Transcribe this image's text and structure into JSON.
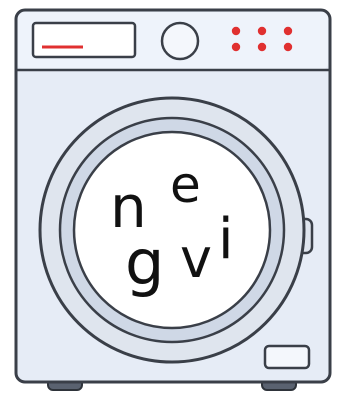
{
  "letters": {
    "n": "n",
    "e": "e",
    "g": "g",
    "v": "v",
    "i": "i"
  },
  "colors": {
    "body": "#e6ecf6",
    "outline": "#3a3f48",
    "panel_top": "#eef3fb",
    "drum_glass": "#ffffff",
    "door_ring": "#dfe5ee",
    "indicator_red": "#e03030",
    "feet": "#5a6270"
  },
  "icons": {
    "display": "display-screen",
    "knob": "dial-knob",
    "buttons": "indicator-dots",
    "door": "porthole-door",
    "handle": "door-handle",
    "drawer": "detergent-drawer"
  }
}
